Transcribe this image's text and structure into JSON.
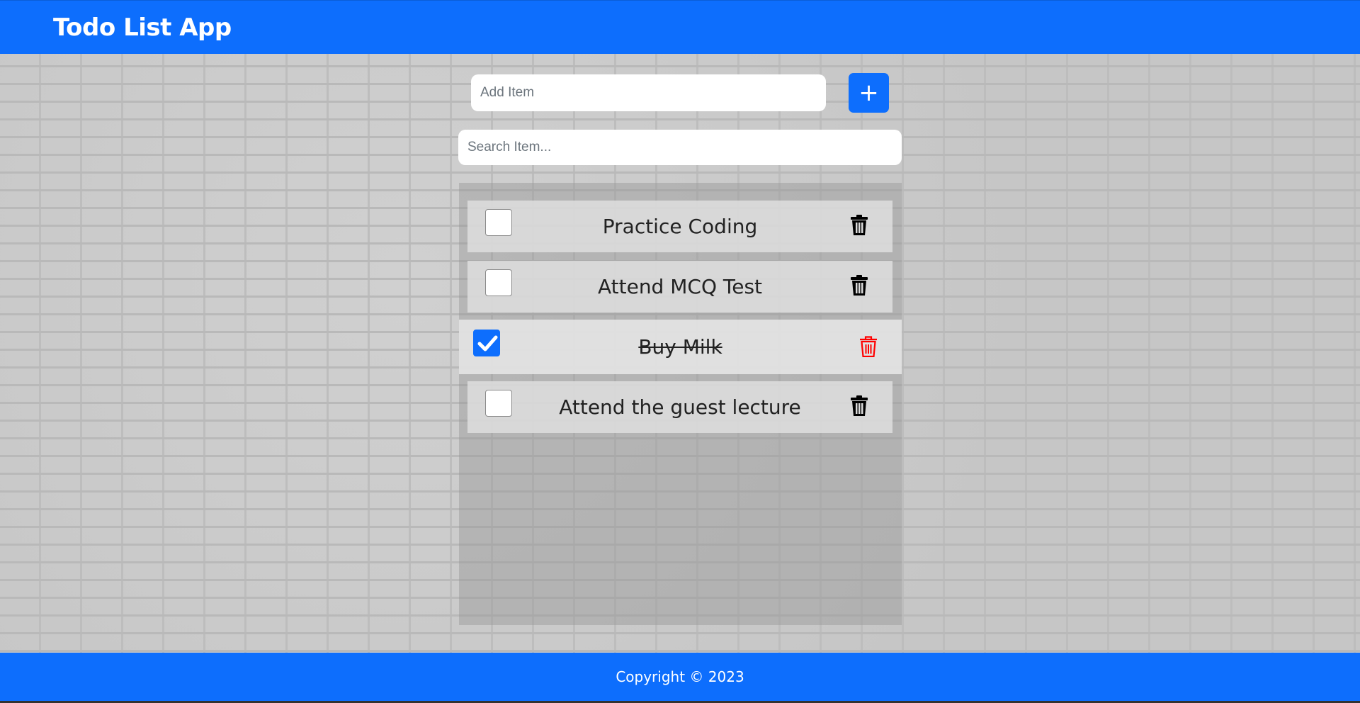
{
  "app": {
    "title": "Todo List App"
  },
  "add": {
    "placeholder": "Add Item",
    "button_label": "+"
  },
  "search": {
    "placeholder": "Search Item..."
  },
  "todos": [
    {
      "text": "Practice Coding",
      "done": false
    },
    {
      "text": "Attend MCQ Test",
      "done": false
    },
    {
      "text": "Buy Milk",
      "done": true
    },
    {
      "text": "Attend the guest lecture",
      "done": false
    }
  ],
  "footer": {
    "text": "Copyright © 2023"
  },
  "colors": {
    "accent": "#0d6efd",
    "delete_active": "#ff0000",
    "delete_default": "#000000"
  }
}
